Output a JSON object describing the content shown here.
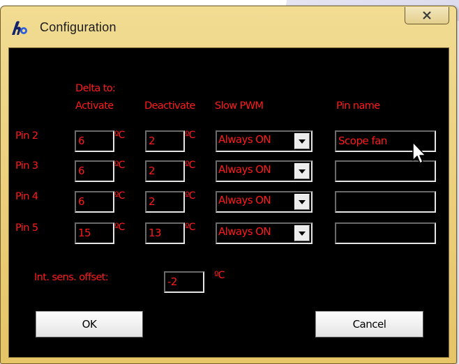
{
  "window": {
    "title": "Configuration"
  },
  "headers": {
    "delta_to": "Delta to:",
    "activate": "Activate",
    "deactivate": "Deactivate",
    "slow_pwm": "Slow PWM",
    "pin_name": "Pin name"
  },
  "rows": [
    {
      "label": "Pin 2",
      "activate": "6",
      "deactivate": "2",
      "pwm": "Always ON",
      "name": "Scope fan"
    },
    {
      "label": "Pin 3",
      "activate": "6",
      "deactivate": "2",
      "pwm": "Always ON",
      "name": ""
    },
    {
      "label": "Pin 4",
      "activate": "6",
      "deactivate": "2",
      "pwm": "Always ON",
      "name": ""
    },
    {
      "label": "Pin 5",
      "activate": "15",
      "deactivate": "13",
      "pwm": "Always ON",
      "name": ""
    }
  ],
  "unit": "ºC",
  "offset": {
    "label": "Int. sens. offset:",
    "value": "-2",
    "unit": "ºC"
  },
  "buttons": {
    "ok": "OK",
    "cancel": "Cancel"
  },
  "colors": {
    "text": "#ff1a1a",
    "background": "#000000",
    "frame": "#e6c467"
  }
}
